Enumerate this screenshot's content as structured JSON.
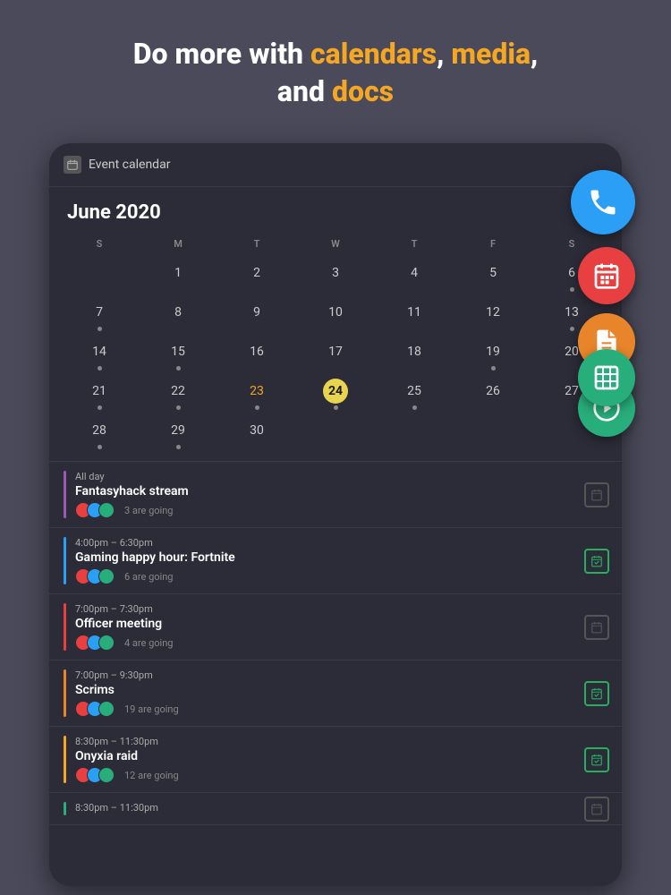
{
  "hero": {
    "line1_plain": "Do more with ",
    "line1_highlight": "calendars",
    "line1_sep": ", ",
    "line2_highlight1": "media",
    "line2_sep": ",",
    "line3_plain": "and ",
    "line3_highlight": "docs"
  },
  "fabs": {
    "phone_label": "phone",
    "calendar_label": "calendar",
    "doc_label": "document",
    "media_label": "media",
    "sheet_label": "spreadsheet"
  },
  "app": {
    "header_title": "Event calendar",
    "month": "June 2020",
    "day_names": [
      "S",
      "M",
      "T",
      "W",
      "T",
      "F",
      "S"
    ],
    "days": [
      {
        "num": "",
        "dot": false
      },
      {
        "num": "1",
        "dot": false
      },
      {
        "num": "2",
        "dot": false
      },
      {
        "num": "3",
        "dot": false
      },
      {
        "num": "4",
        "dot": false
      },
      {
        "num": "5",
        "dot": false
      },
      {
        "num": "6",
        "dot": true
      },
      {
        "num": "",
        "dot": false
      },
      {
        "num": "7",
        "dot": true
      },
      {
        "num": "8",
        "dot": false
      },
      {
        "num": "9",
        "dot": false
      },
      {
        "num": "10",
        "dot": false
      },
      {
        "num": "11",
        "dot": false
      },
      {
        "num": "12",
        "dot": false
      },
      {
        "num": "13",
        "dot": true
      },
      {
        "num": "14",
        "dot": true
      },
      {
        "num": "15",
        "dot": true
      },
      {
        "num": "16",
        "dot": false
      },
      {
        "num": "17",
        "dot": false
      },
      {
        "num": "18",
        "dot": false
      },
      {
        "num": "19",
        "dot": true
      },
      {
        "num": "20",
        "dot": false
      },
      {
        "num": "21",
        "dot": true
      },
      {
        "num": "22",
        "dot": true
      },
      {
        "num": "23",
        "dot": true,
        "orange": true
      },
      {
        "num": "24",
        "dot": true,
        "today": true
      },
      {
        "num": "25",
        "dot": true
      },
      {
        "num": "26",
        "dot": false
      },
      {
        "num": "27",
        "dot": false
      },
      {
        "num": "28",
        "dot": true
      },
      {
        "num": "29",
        "dot": true
      },
      {
        "num": "30",
        "dot": false
      }
    ],
    "events": [
      {
        "time": "All day",
        "time_icon": "🗓",
        "name": "Fantasyhack stream",
        "going": "3 are going",
        "bar_color": "bar-purple",
        "rsvp_active": false
      },
      {
        "time": "4:00pm – 6:30pm",
        "time_icon": "🎮",
        "name": "Gaming happy hour: Fortnite",
        "going": "6 are going",
        "bar_color": "bar-blue",
        "rsvp_active": true
      },
      {
        "time": "7:00pm – 7:30pm",
        "time_icon": "▼",
        "name": "Officer meeting",
        "going": "4 are going",
        "bar_color": "bar-red",
        "rsvp_active": false
      },
      {
        "time": "7:00pm – 9:30pm",
        "time_icon": "🎮",
        "name": "Scrims",
        "going": "19 are going",
        "bar_color": "bar-orange",
        "rsvp_active": true
      },
      {
        "time": "8:30pm – 11:30pm",
        "time_icon": "🐉",
        "name": "Onyxia raid",
        "going": "12 are going",
        "bar_color": "bar-yellow",
        "rsvp_active": true
      },
      {
        "time": "8:30pm – 11:30pm",
        "time_icon": "L",
        "name": "",
        "going": "",
        "bar_color": "bar-green",
        "rsvp_active": false
      }
    ]
  }
}
